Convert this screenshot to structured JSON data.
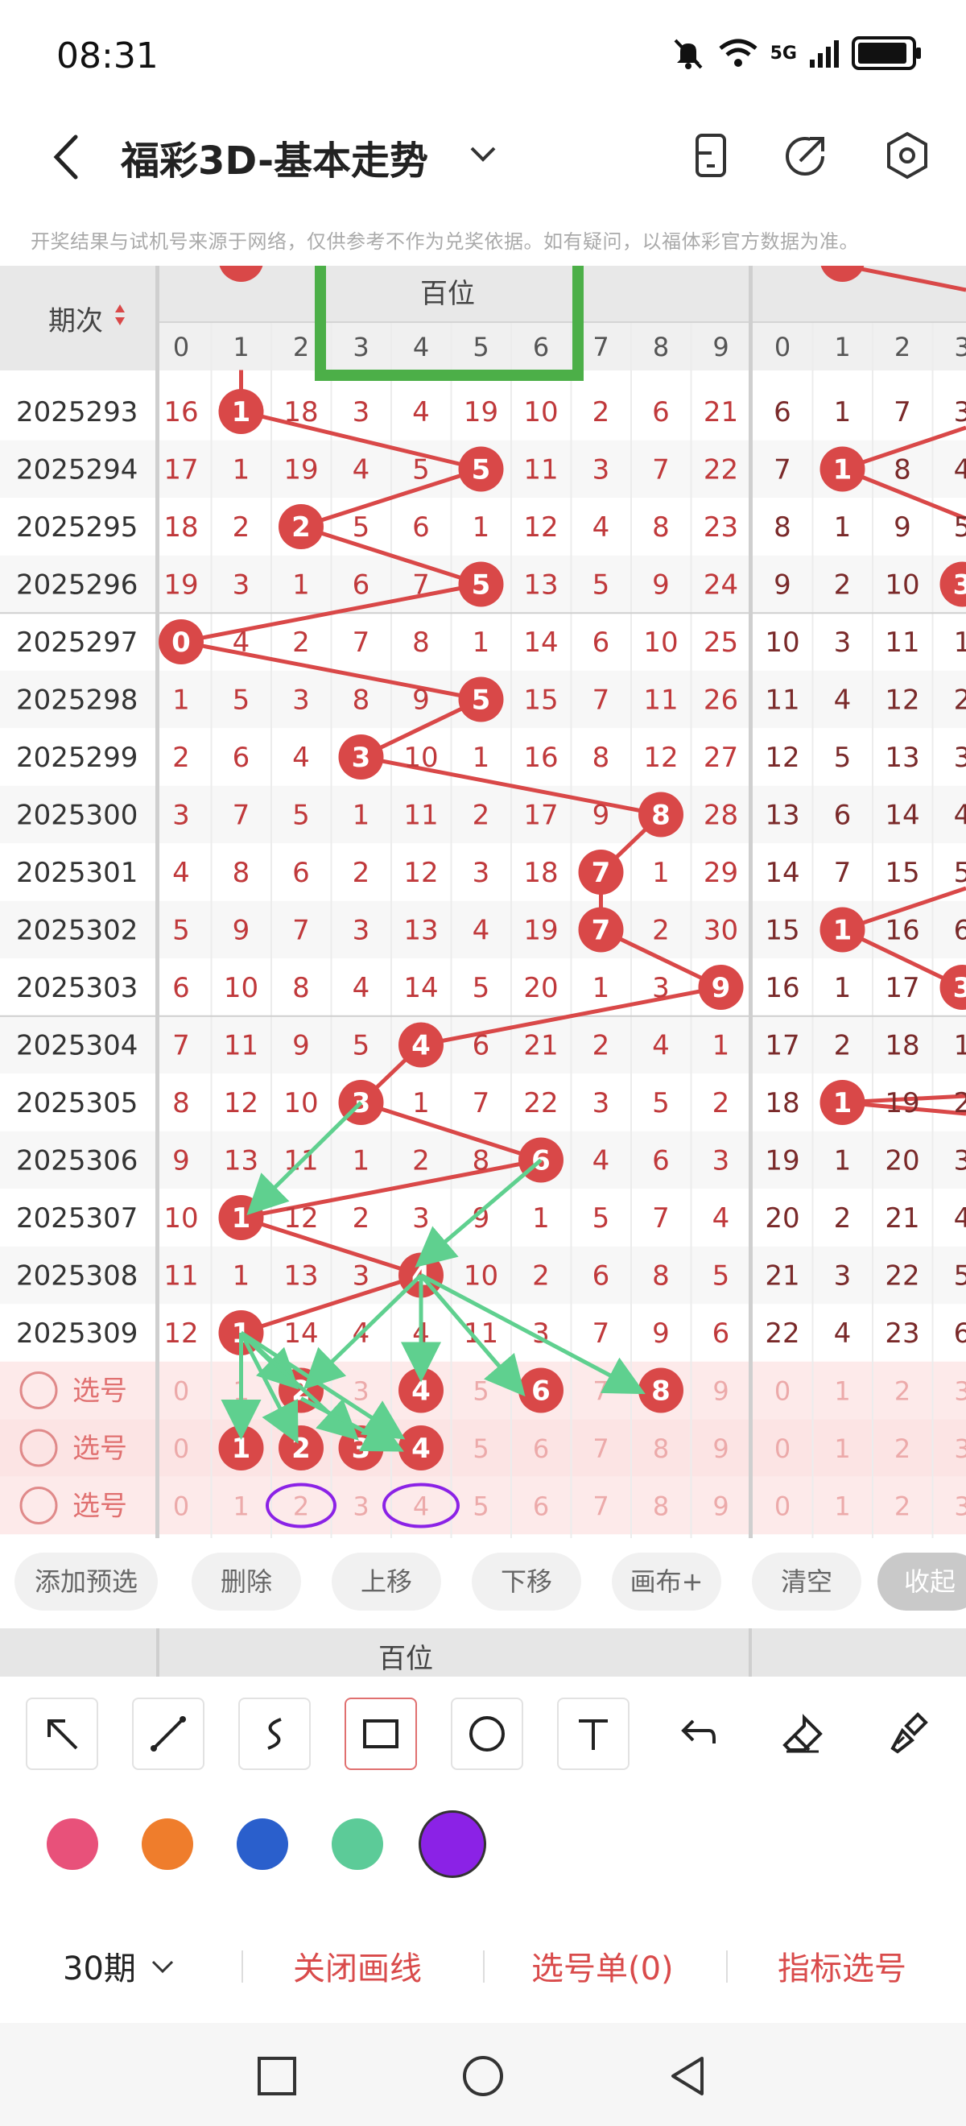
{
  "status_bar": {
    "time": "08:31",
    "network": "5G"
  },
  "header": {
    "title": "福彩3D-基本走势"
  },
  "disclaimer": "开奖结果与试机号来源于网络，仅供参考不作为兑奖依据。如有疑问，以福体彩官方数据为准。",
  "table": {
    "period_header": "期次",
    "group_label": "百位",
    "digit_headers": [
      "0",
      "1",
      "2",
      "3",
      "4",
      "5",
      "6",
      "7",
      "8",
      "9"
    ],
    "rows": [
      {
        "period": "2025293",
        "hundreds": [
          16,
          1,
          18,
          3,
          4,
          19,
          10,
          2,
          6,
          21
        ],
        "hundreds_hit": 1,
        "tens": [
          6,
          1,
          7,
          3
        ],
        "tens_hit": -1
      },
      {
        "period": "2025294",
        "hundreds": [
          17,
          1,
          19,
          4,
          5,
          5,
          11,
          3,
          7,
          22
        ],
        "hundreds_hit": 5,
        "tens": [
          7,
          1,
          8,
          4
        ],
        "tens_hit": 1
      },
      {
        "period": "2025295",
        "hundreds": [
          18,
          2,
          2,
          5,
          6,
          1,
          12,
          4,
          8,
          23
        ],
        "hundreds_hit": 2,
        "tens": [
          8,
          1,
          9,
          5
        ],
        "tens_hit": -1
      },
      {
        "period": "2025296",
        "hundreds": [
          19,
          3,
          1,
          6,
          7,
          5,
          13,
          5,
          9,
          24
        ],
        "hundreds_hit": 5,
        "tens": [
          9,
          2,
          10,
          3
        ],
        "tens_hit": 3
      },
      {
        "period": "2025297",
        "hundreds": [
          0,
          4,
          2,
          7,
          8,
          1,
          14,
          6,
          10,
          25
        ],
        "hundreds_hit": 0,
        "tens": [
          10,
          3,
          11,
          1
        ],
        "tens_hit": -1
      },
      {
        "period": "2025298",
        "hundreds": [
          1,
          5,
          3,
          8,
          9,
          5,
          15,
          7,
          11,
          26
        ],
        "hundreds_hit": 5,
        "tens": [
          11,
          4,
          12,
          2
        ],
        "tens_hit": -1
      },
      {
        "period": "2025299",
        "hundreds": [
          2,
          6,
          4,
          3,
          10,
          1,
          16,
          8,
          12,
          27
        ],
        "hundreds_hit": 3,
        "tens": [
          12,
          5,
          13,
          3
        ],
        "tens_hit": -1
      },
      {
        "period": "2025300",
        "hundreds": [
          3,
          7,
          5,
          1,
          11,
          2,
          17,
          9,
          8,
          28
        ],
        "hundreds_hit": 8,
        "tens": [
          13,
          6,
          14,
          4
        ],
        "tens_hit": -1
      },
      {
        "period": "2025301",
        "hundreds": [
          4,
          8,
          6,
          2,
          12,
          3,
          18,
          7,
          1,
          29
        ],
        "hundreds_hit": 7,
        "tens": [
          14,
          7,
          15,
          5
        ],
        "tens_hit": -1
      },
      {
        "period": "2025302",
        "hundreds": [
          5,
          9,
          7,
          3,
          13,
          4,
          19,
          7,
          2,
          30
        ],
        "hundreds_hit": 7,
        "tens": [
          15,
          1,
          16,
          6
        ],
        "tens_hit": 1
      },
      {
        "period": "2025303",
        "hundreds": [
          6,
          10,
          8,
          4,
          14,
          5,
          20,
          1,
          3,
          9
        ],
        "hundreds_hit": 9,
        "tens": [
          16,
          1,
          17,
          3
        ],
        "tens_hit": 3
      },
      {
        "period": "2025304",
        "hundreds": [
          7,
          11,
          9,
          5,
          4,
          6,
          21,
          2,
          4,
          1
        ],
        "hundreds_hit": 4,
        "tens": [
          17,
          2,
          18,
          1
        ],
        "tens_hit": -1
      },
      {
        "period": "2025305",
        "hundreds": [
          8,
          12,
          10,
          3,
          1,
          7,
          22,
          3,
          5,
          2
        ],
        "hundreds_hit": 3,
        "tens": [
          18,
          1,
          19,
          2
        ],
        "tens_hit": 1
      },
      {
        "period": "2025306",
        "hundreds": [
          9,
          13,
          11,
          1,
          2,
          8,
          6,
          4,
          6,
          3
        ],
        "hundreds_hit": 6,
        "tens": [
          19,
          1,
          20,
          3
        ],
        "tens_hit": -1
      },
      {
        "period": "2025307",
        "hundreds": [
          10,
          1,
          12,
          2,
          3,
          9,
          1,
          5,
          7,
          4
        ],
        "hundreds_hit": 1,
        "tens": [
          20,
          2,
          21,
          4
        ],
        "tens_hit": -1
      },
      {
        "period": "2025308",
        "hundreds": [
          11,
          1,
          13,
          3,
          4,
          10,
          2,
          6,
          8,
          5
        ],
        "hundreds_hit": 4,
        "tens": [
          21,
          3,
          22,
          5
        ],
        "tens_hit": -1
      },
      {
        "period": "2025309",
        "hundreds": [
          12,
          1,
          14,
          4,
          4,
          11,
          3,
          7,
          9,
          6
        ],
        "hundreds_hit": 1,
        "tens": [
          22,
          4,
          23,
          6
        ],
        "tens_hit": -1
      }
    ],
    "pick_rows": [
      {
        "label": "选号",
        "selected": [
          2,
          4,
          6,
          8
        ]
      },
      {
        "label": "选号",
        "selected": [
          1,
          2,
          3,
          4
        ]
      },
      {
        "label": "选号",
        "selected": []
      }
    ],
    "pick_tens_row": [
      "0",
      "1",
      "2",
      "3"
    ]
  },
  "actions": {
    "add": "添加预选",
    "delete": "删除",
    "up": "上移",
    "down": "下移",
    "canvas": "画布+",
    "clear": "清空",
    "collapse": "收起"
  },
  "section_label": "百位",
  "tools": [
    "arrow-icon",
    "line-icon",
    "curve-icon",
    "rectangle-icon",
    "circle-icon",
    "text-icon",
    "undo-icon",
    "eraser-icon",
    "brush-icon"
  ],
  "palette": {
    "colors": [
      "#e8517a",
      "#ef7d2c",
      "#2a5fcc",
      "#5ccb98",
      "#8b22e6"
    ],
    "selected_index": 4
  },
  "bottom": {
    "period": "30期",
    "close_draw": "关闭画线",
    "pick_list": "选号单(0)",
    "indicator_pick": "指标选号"
  },
  "theme": {
    "red": "#d94848",
    "green_box": "#4caf48",
    "arrow": "#5fd08f",
    "oval": "#8b22e6"
  }
}
